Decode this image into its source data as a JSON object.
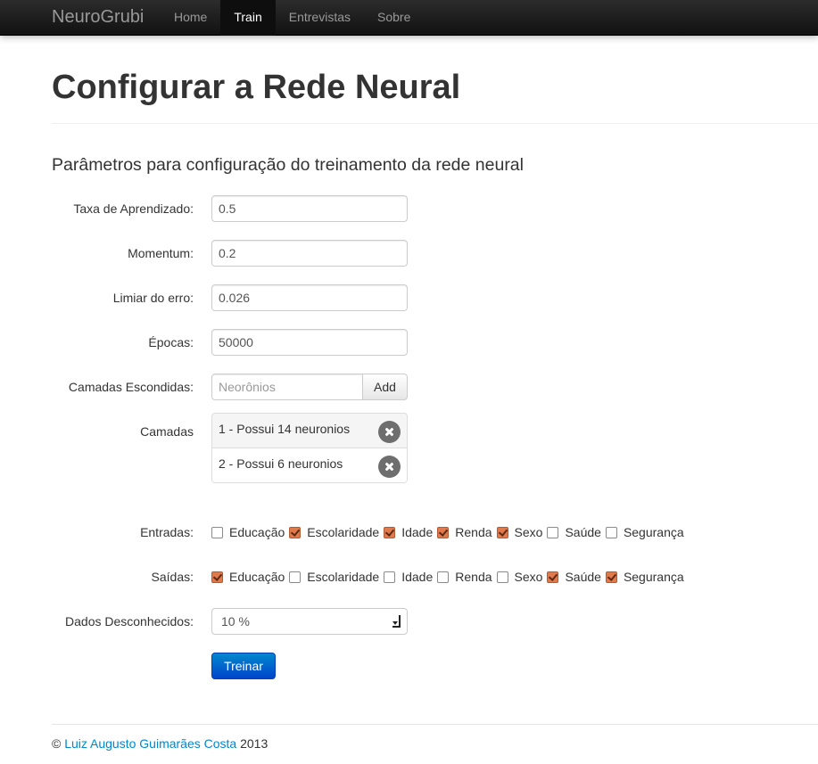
{
  "navbar": {
    "brand": "NeuroGrubi",
    "items": [
      {
        "label": "Home",
        "active": false
      },
      {
        "label": "Train",
        "active": true
      },
      {
        "label": "Entrevistas",
        "active": false
      },
      {
        "label": "Sobre",
        "active": false
      }
    ]
  },
  "page": {
    "title": "Configurar a Rede Neural",
    "subtitle": "Parâmetros para configuração do treinamento da rede neural"
  },
  "form": {
    "learning_rate": {
      "label": "Taxa de Aprendizado:",
      "value": "0.5"
    },
    "momentum": {
      "label": "Momentum:",
      "value": "0.2"
    },
    "error_threshold": {
      "label": "Limiar do erro:",
      "value": "0.026"
    },
    "epochs": {
      "label": "Épocas:",
      "value": "50000"
    },
    "hidden_layers": {
      "label": "Camadas Escondidas:",
      "placeholder": "Neorônios",
      "add_label": "Add"
    },
    "layers": {
      "label": "Camadas",
      "items": [
        "1 - Possui 14 neuronios",
        "2 - Possui 6 neuronios"
      ]
    },
    "inputs": {
      "label": "Entradas:",
      "options": [
        {
          "label": "Educação",
          "checked": false
        },
        {
          "label": "Escolaridade",
          "checked": true
        },
        {
          "label": "Idade",
          "checked": true
        },
        {
          "label": "Renda",
          "checked": true
        },
        {
          "label": "Sexo",
          "checked": true
        },
        {
          "label": "Saúde",
          "checked": false
        },
        {
          "label": "Segurança",
          "checked": false
        }
      ]
    },
    "outputs": {
      "label": "Saídas:",
      "options": [
        {
          "label": "Educação",
          "checked": true
        },
        {
          "label": "Escolaridade",
          "checked": false
        },
        {
          "label": "Idade",
          "checked": false
        },
        {
          "label": "Renda",
          "checked": false
        },
        {
          "label": "Sexo",
          "checked": false
        },
        {
          "label": "Saúde",
          "checked": true
        },
        {
          "label": "Segurança",
          "checked": true
        }
      ]
    },
    "unknown_data": {
      "label": "Dados Desconhecidos:",
      "value": "10 %"
    },
    "train_label": "Treinar"
  },
  "footer": {
    "copyright": "©",
    "author": "Luiz Augusto Guimarães Costa",
    "year": "2013"
  },
  "colors": {
    "accent": "#0088cc",
    "checkbox_checked": "#e07a4d"
  }
}
